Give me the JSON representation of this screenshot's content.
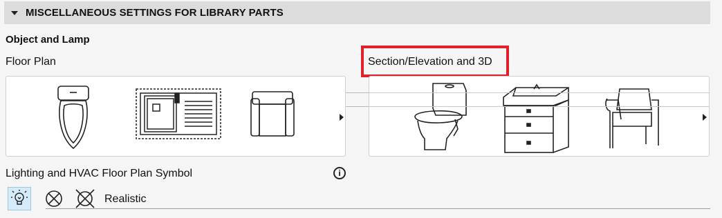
{
  "panel": {
    "title": "MISCELLANEOUS SETTINGS FOR LIBRARY PARTS",
    "expanded": true
  },
  "object_lamp": {
    "heading": "Object and Lamp",
    "floor_plan_label": "Floor Plan",
    "section_label": "Section/Elevation and 3D",
    "floor_plan_icons": [
      "toilet-plan-icon",
      "sink-cabinet-plan-icon",
      "armchair-plan-icon"
    ],
    "section_icons": [
      "toilet-3d-icon",
      "vanity-3d-icon",
      "armchair-3d-icon"
    ]
  },
  "lighting": {
    "label": "Lighting and HVAC Floor Plan Symbol",
    "info_glyph": "i",
    "options": [
      "bulb-symbol-icon",
      "crossed-circle-icon",
      "realistic-lamp-icon"
    ],
    "selected": "bulb-symbol-icon",
    "realistic_label": "Realistic"
  },
  "colors": {
    "highlight": "#e0202a",
    "selected_bg": "#d6ebfa",
    "header_bg": "#dcdcdc"
  }
}
